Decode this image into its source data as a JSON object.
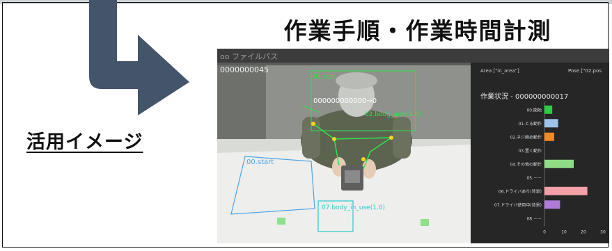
{
  "heading": "作業手順・作業時間計測",
  "usage_label": "活用イメージ",
  "app": {
    "title": "oo ファイルパス"
  },
  "video": {
    "frame_counter": "0000000045",
    "person_box_label": "01.stat",
    "person_id": "000000000000→0",
    "hand_label": "02.bodg_arm(2.0)",
    "start_zone_label": "00.start",
    "bottom_zone_label": "07.body_in_use(1.0)"
  },
  "panel": {
    "area_label": "Area [\"in_area\"]",
    "pose_label": "Pose [\"02.pos",
    "status_title": "作業状況 - 000000000017"
  },
  "chart_data": {
    "type": "bar",
    "orientation": "horizontal",
    "categories": [
      "00.開始",
      "01.とる動作",
      "02.ネジ締め動作",
      "03.置く動作",
      "04.その他の動作",
      "05.－－",
      "06.ドライバあり(背景)",
      "07.ドライバ使用中(背景)",
      "08.－－"
    ],
    "values": [
      4,
      7,
      5,
      0,
      15,
      0,
      22,
      8,
      0
    ],
    "colors": [
      "#2ecc40",
      "#9ec3ea",
      "#f08a24",
      "#888888",
      "#8fdc86",
      "#888888",
      "#f4a0a8",
      "#b07ad8",
      "#888888"
    ],
    "ticks": [
      "0",
      "10",
      "20",
      "30"
    ],
    "xlim": [
      0,
      30
    ]
  }
}
